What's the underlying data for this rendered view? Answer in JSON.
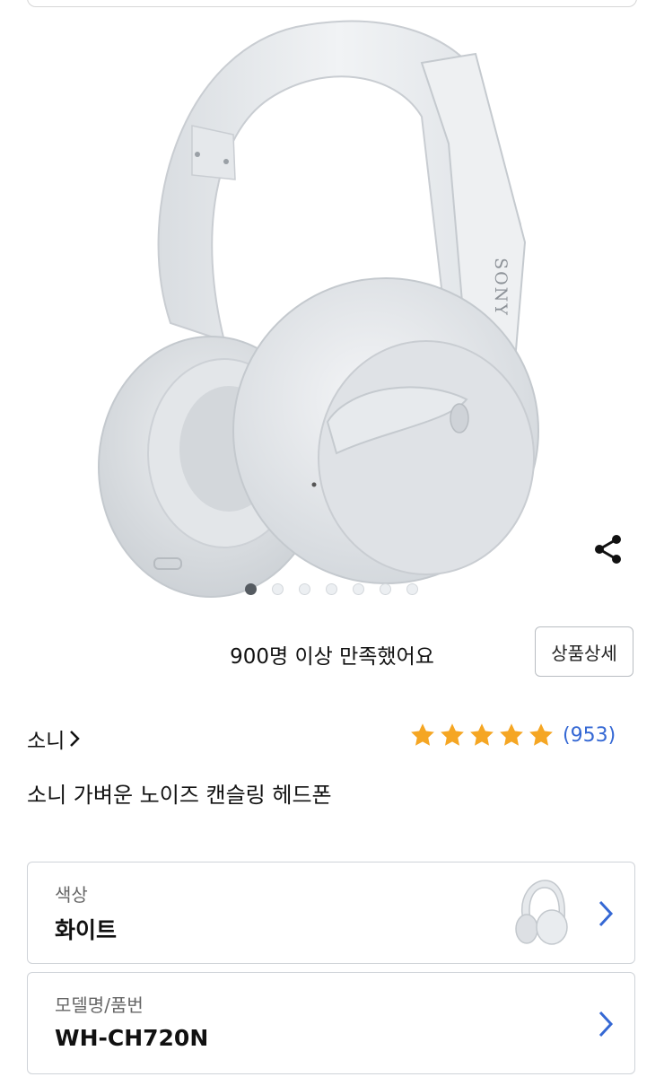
{
  "hero": {
    "brand_mark": "SONY",
    "carousel": {
      "total": 7,
      "active_index": 0
    }
  },
  "satisfaction": {
    "count_text": "900명 이상",
    "suffix_text": " 만족했어요",
    "detail_button": "상품상세"
  },
  "product": {
    "brand": "소니",
    "rating": 5,
    "review_count": "(953)",
    "title": "소니 가벼운 노이즈 캔슬링 헤드폰"
  },
  "options": [
    {
      "label": "색상",
      "value": "화이트"
    },
    {
      "label": "모델명/품번",
      "value": "WH-CH720N"
    }
  ],
  "colors": {
    "star": "#f5a623",
    "link": "#3568d4",
    "chevron": "#3568d4",
    "headphone": "#e9ebee"
  }
}
